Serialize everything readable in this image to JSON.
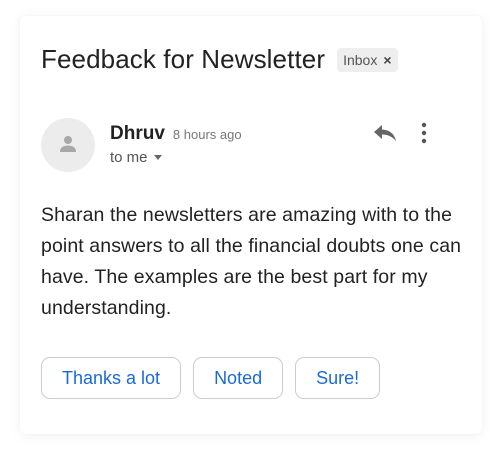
{
  "email": {
    "subject": "Feedback for Newsletter",
    "label": "Inbox",
    "label_remove": "×",
    "sender": "Dhruv",
    "time": "8 hours ago",
    "recipient": "to me",
    "body": "Sharan the newsletters are amazing with to the point answers to all the financial doubts one can have. The examples are the best part for my understanding."
  },
  "icons": {
    "avatar": "person-icon",
    "reply": "reply-arrow-icon",
    "more": "vertical-dots-icon",
    "recipient_toggle": "caret-down-icon"
  },
  "smart_replies": [
    {
      "label": "Thanks a lot"
    },
    {
      "label": "Noted"
    },
    {
      "label": "Sure!"
    }
  ],
  "colors": {
    "accent": "#1a6ad6",
    "text": "#222222",
    "muted": "#777777",
    "chip_bg": "#eeeeee",
    "avatar_bg": "#ececec"
  }
}
